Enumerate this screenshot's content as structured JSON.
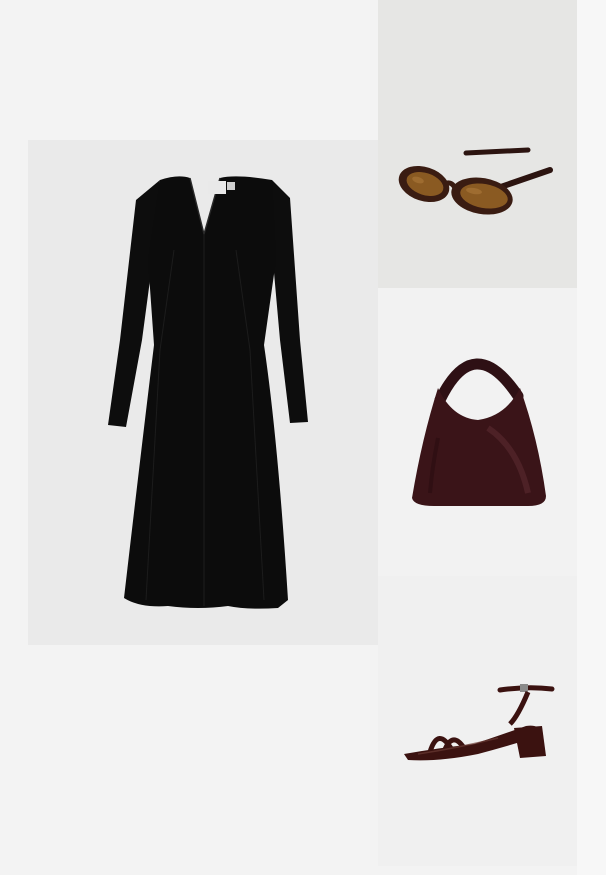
{
  "page": {
    "background": "#f3f3f3"
  },
  "products": [
    {
      "id": "dress",
      "icon": "black-long-sleeve-v-neck-midi-dress",
      "tag_text": ""
    },
    {
      "id": "sunglasses",
      "icon": "tortoiseshell-oval-sunglasses-brown-lens"
    },
    {
      "id": "bag",
      "icon": "burgundy-leather-hobo-bag"
    },
    {
      "id": "sandal",
      "icon": "burgundy-patent-block-heel-strappy-sandal"
    }
  ],
  "colors": {
    "dress": "#0c0c0c",
    "tortoise": "#3a1c12",
    "lens": "#8a5a22",
    "bag": "#3a1418",
    "sandal": "#3b1210"
  }
}
